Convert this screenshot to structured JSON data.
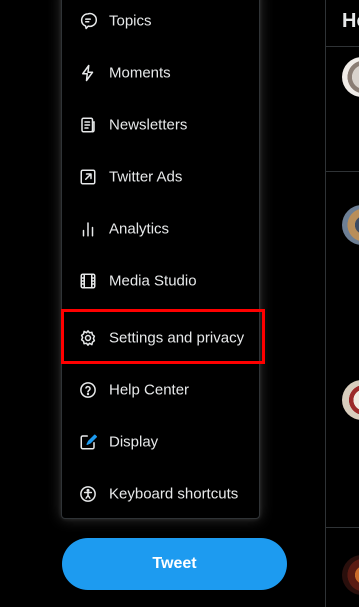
{
  "menu": {
    "items": [
      {
        "label": "Topics",
        "icon": "topics-icon"
      },
      {
        "label": "Moments",
        "icon": "lightning-icon"
      },
      {
        "label": "Newsletters",
        "icon": "newsletter-icon"
      },
      {
        "label": "Twitter Ads",
        "icon": "external-link-icon"
      },
      {
        "label": "Analytics",
        "icon": "analytics-icon"
      },
      {
        "label": "Media Studio",
        "icon": "film-icon"
      },
      {
        "label": "Settings and privacy",
        "icon": "gear-icon"
      },
      {
        "label": "Help Center",
        "icon": "help-icon"
      },
      {
        "label": "Display",
        "icon": "display-icon"
      },
      {
        "label": "Keyboard shortcuts",
        "icon": "accessibility-icon"
      }
    ]
  },
  "tweet_button": {
    "label": "Tweet"
  },
  "timeline": {
    "title": "Home"
  },
  "colors": {
    "accent": "#1d9bf0",
    "highlight": "#ff0000",
    "background": "#000000",
    "border": "#2f3336"
  }
}
